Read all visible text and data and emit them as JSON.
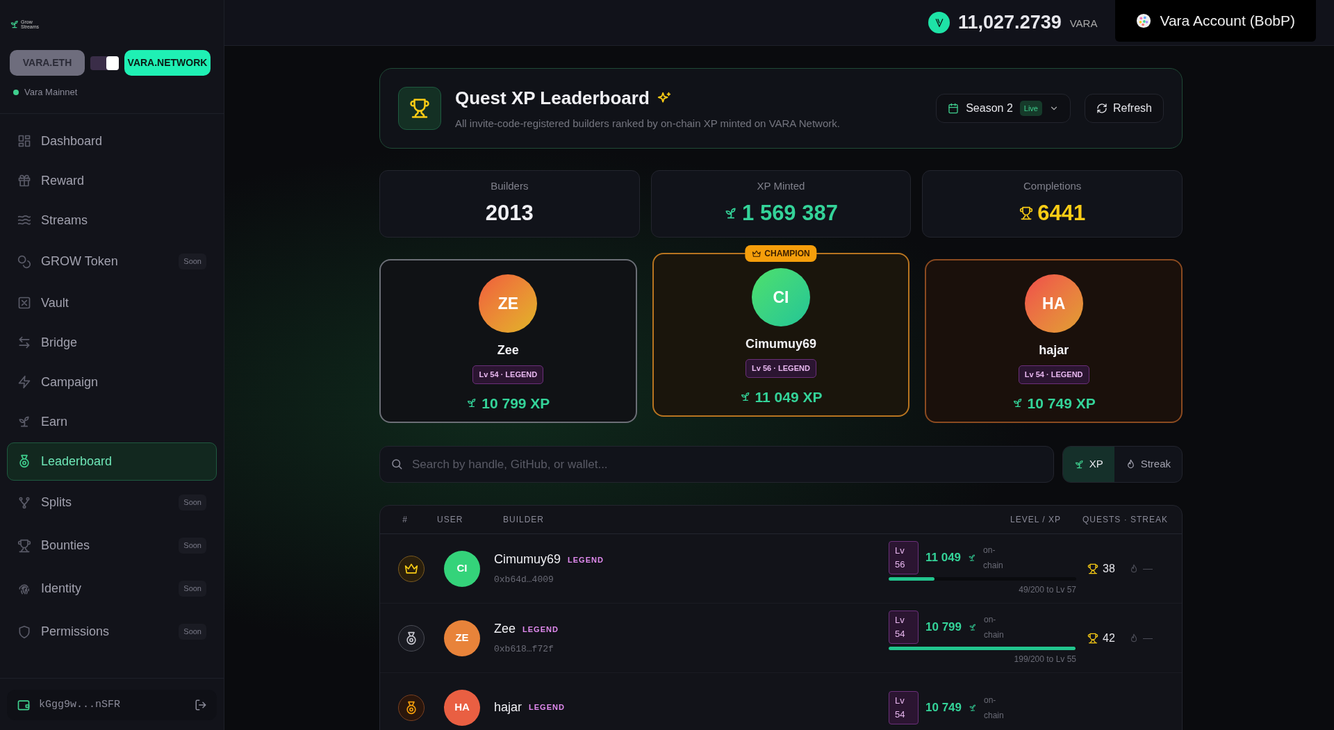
{
  "brand": {
    "name": "Grow Streams"
  },
  "networks": [
    {
      "label": "VARA.ETH",
      "selected": false
    },
    {
      "label": "VARA.NETWORK",
      "selected": true
    }
  ],
  "network_toggle": {
    "on": true
  },
  "network_status": {
    "label": "Vara Mainnet",
    "online": true
  },
  "nav": [
    {
      "label": "Dashboard",
      "selected": false
    },
    {
      "label": "Reward",
      "selected": false
    },
    {
      "label": "Streams",
      "selected": false
    },
    {
      "label": "GROW Token",
      "selected": false,
      "badge": "Soon"
    },
    {
      "label": "Vault",
      "selected": false
    },
    {
      "label": "Bridge",
      "selected": false
    },
    {
      "label": "Campaign",
      "selected": false
    },
    {
      "label": "Earn",
      "selected": false
    },
    {
      "label": "Leaderboard",
      "selected": true
    },
    {
      "label": "Splits",
      "selected": false,
      "badge": "Soon"
    },
    {
      "label": "Bounties",
      "selected": false,
      "badge": "Soon"
    },
    {
      "label": "Identity",
      "selected": false,
      "badge": "Soon"
    },
    {
      "label": "Permissions",
      "selected": false,
      "badge": "Soon"
    }
  ],
  "wallet": {
    "address": "kGgg9w...nSFR"
  },
  "topbar": {
    "balance": "11,027.2739",
    "currency": "VARA",
    "account": "Vara Account (BobP)"
  },
  "header": {
    "title": "Quest XP Leaderboard",
    "subtitle": "All invite-code-registered builders ranked by on-chain XP minted on VARA Network.",
    "season": "Season 2",
    "season_badge": "Live",
    "refresh": "Refresh"
  },
  "stats": [
    {
      "label": "Builders",
      "value": "2013",
      "kind": "plain"
    },
    {
      "label": "XP Minted",
      "value": "1 569 387",
      "kind": "xp"
    },
    {
      "label": "Completions",
      "value": "6441",
      "kind": "trophy"
    }
  ],
  "podium": [
    {
      "kind": "second",
      "initials": "ZE",
      "name": "Zee",
      "level": "Lv 54 · LEGEND",
      "xp": "10 799 XP"
    },
    {
      "kind": "champion",
      "badge": "CHAMPION",
      "initials": "CI",
      "name": "Cimumuy69",
      "level": "Lv 56 · LEGEND",
      "xp": "11 049 XP"
    },
    {
      "kind": "third",
      "initials": "HA",
      "name": "hajar",
      "level": "Lv 54 · LEGEND",
      "xp": "10 749 XP"
    }
  ],
  "search": {
    "placeholder": "Search by handle, GitHub, or wallet..."
  },
  "sort_tabs": [
    {
      "label": "XP",
      "selected": true
    },
    {
      "label": "Streak",
      "selected": false
    }
  ],
  "table": {
    "columns": [
      "#",
      "USER",
      "BUILDER",
      "LEVEL / XP",
      "QUESTS · STREAK"
    ],
    "rows": [
      {
        "kind": "gold",
        "initials": "CI",
        "color": "#34d37a",
        "name": "Cimumuy69",
        "tier": "LEGEND",
        "address": "0xb64d…4009",
        "lv": "Lv",
        "lv_num": "56",
        "xp": "11 049",
        "xp_note": "on-chain",
        "level": 0.245,
        "progress": "49/200 to Lv 57",
        "quests": "38",
        "streak": "—"
      },
      {
        "kind": "silver",
        "initials": "ZE",
        "color": "#e8833a",
        "name": "Zee",
        "tier": "LEGEND",
        "address": "0xb618…f72f",
        "lv": "Lv",
        "lv_num": "54",
        "xp": "10 799",
        "xp_note": "on-chain",
        "level": 0.995,
        "progress": "199/200 to Lv 55",
        "quests": "42",
        "streak": "—"
      },
      {
        "kind": "bronze",
        "initials": "HA",
        "color": "#e95f42",
        "name": "hajar",
        "tier": "LEGEND",
        "lv": "Lv",
        "lv_num": "54",
        "xp": "10 749",
        "xp_note": "on-chain"
      }
    ]
  }
}
